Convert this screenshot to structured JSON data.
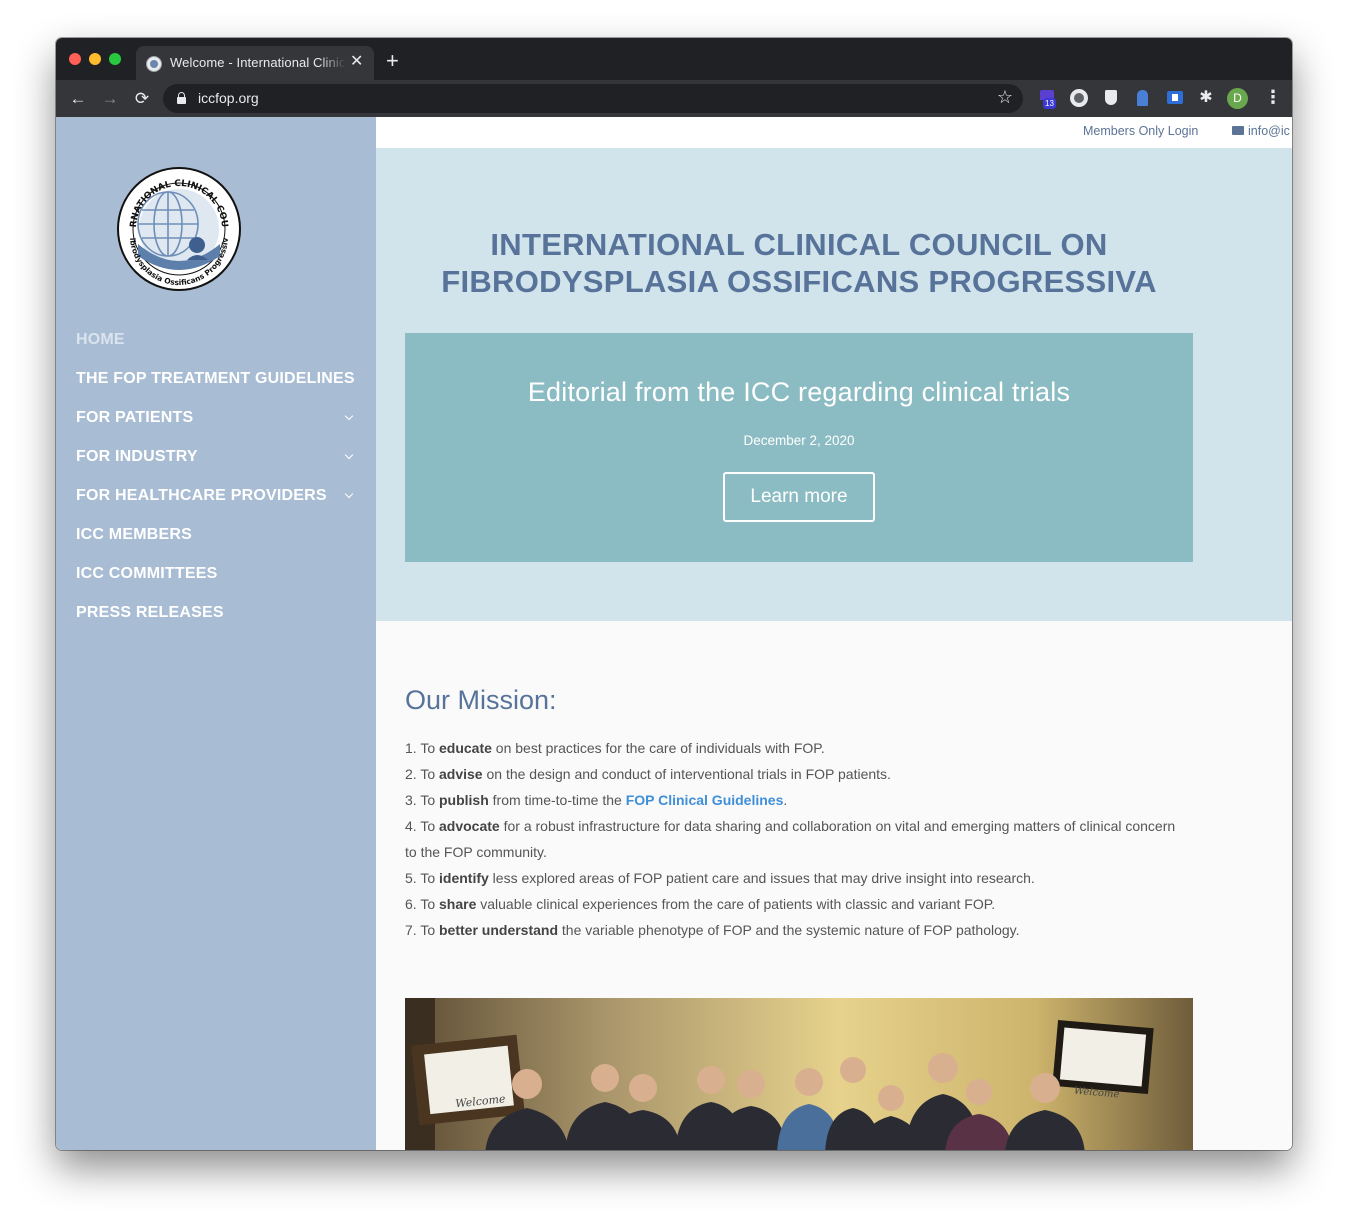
{
  "browser": {
    "tab_title": "Welcome - International Clinical Council on FOP",
    "tab_close": "✕",
    "new_tab": "+",
    "url": "iccfop.org",
    "extension_badge": "13",
    "profile_initial": "D",
    "icons": {
      "back": "←",
      "forward": "→",
      "reload": "⟳",
      "star": "☆",
      "puzzle": "✱",
      "menu": "⋮"
    }
  },
  "topbar": {
    "members_login": "Members Only Login",
    "email": "info@ic"
  },
  "sidebar": {
    "logo": {
      "top_text": "INTERNATIONAL CLINICAL COUNCIL",
      "bottom_text": "Fibrodysplasia Ossificans Progressiva"
    },
    "items": [
      {
        "label": "HOME",
        "active": true
      },
      {
        "label": "THE FOP TREATMENT GUIDELINES"
      },
      {
        "label": "FOR PATIENTS",
        "submenu": true
      },
      {
        "label": "FOR INDUSTRY",
        "submenu": true
      },
      {
        "label": "FOR HEALTHCARE PROVIDERS",
        "submenu": true
      },
      {
        "label": "ICC MEMBERS"
      },
      {
        "label": "ICC COMMITTEES"
      },
      {
        "label": "PRESS RELEASES"
      }
    ]
  },
  "hero": {
    "title_line1": "INTERNATIONAL CLINICAL COUNCIL ON",
    "title_line2": "FIBRODYSPLASIA OSSIFICANS PROGRESSIVA",
    "slide": {
      "title": "Editorial from the ICC regarding clinical trials",
      "date": "December 2, 2020",
      "button": "Learn more"
    }
  },
  "mission": {
    "title": "Our Mission:",
    "items": [
      {
        "prefix": "1. To ",
        "bold": "educate",
        "rest": " on best practices for the care of individuals with FOP."
      },
      {
        "prefix": "2. To ",
        "bold": "advise",
        "rest": " on the design and conduct of interventional trials in FOP patients."
      },
      {
        "prefix": "3. To ",
        "bold": "publish",
        "rest": " from time-to-time the ",
        "link": "FOP Clinical Guidelines",
        "after": "."
      },
      {
        "prefix": "4. To ",
        "bold": "advocate",
        "rest": " for a robust infrastructure for data sharing and collaboration on vital and emerging matters of clinical concern to the FOP community."
      },
      {
        "prefix": "5. To ",
        "bold": "identify",
        "rest": " less explored areas of FOP patient care and issues that may drive insight into research."
      },
      {
        "prefix": "6. To ",
        "bold": "share",
        "rest": " valuable clinical experiences from the care of patients with classic and variant FOP."
      },
      {
        "prefix": "7. To ",
        "bold": "better understand",
        "rest": " the variable phenotype of FOP and the systemic nature of FOP pathology."
      }
    ],
    "photo": {
      "screen_text_left": "Welcome",
      "screen_text_right": "Welcome"
    }
  },
  "colors": {
    "sidebar": "#a8bcd3",
    "hero_bg": "#d1e3eb",
    "slide_bg": "#8cbcc3",
    "heading": "#58739a",
    "link": "#3f8ed8"
  }
}
